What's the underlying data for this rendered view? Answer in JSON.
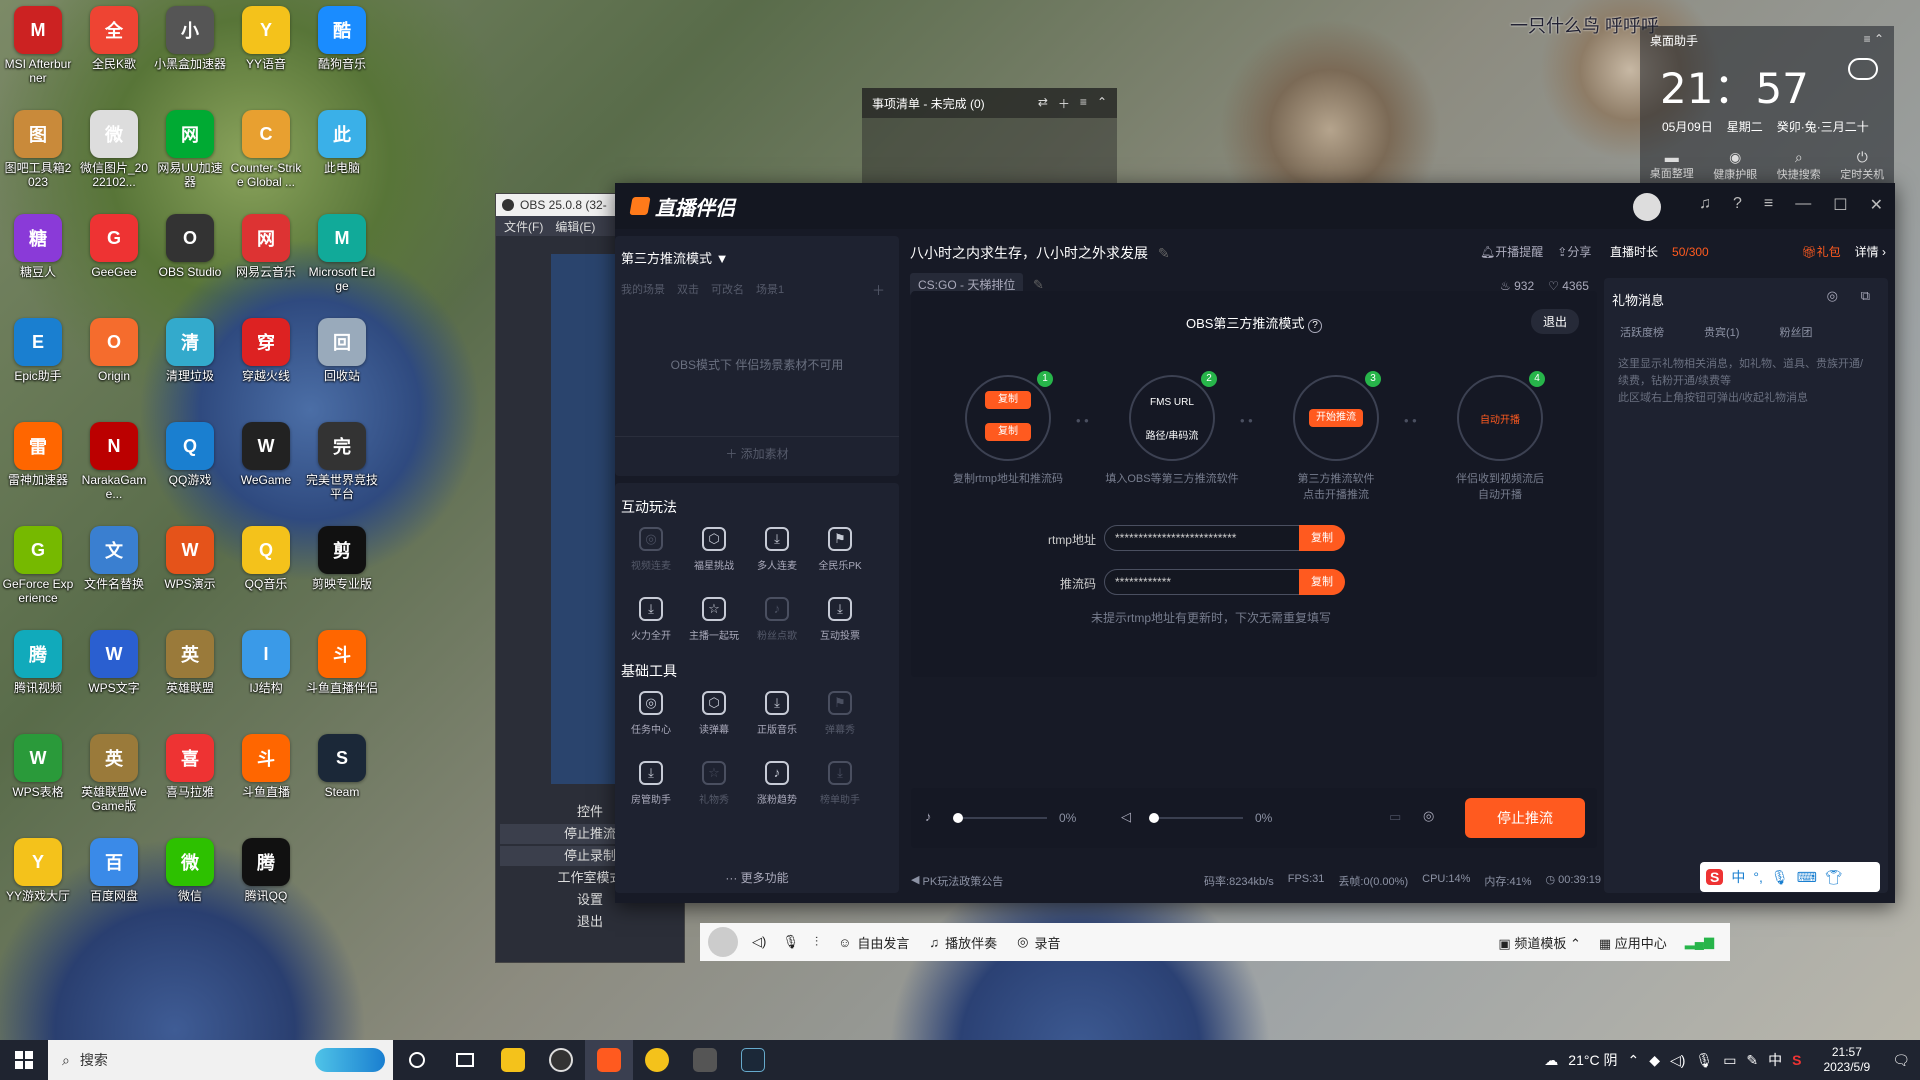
{
  "desktop": {
    "icons": [
      {
        "label": "MSI Afterburner",
        "icon": "msi-afterburner-icon",
        "color": "#c22"
      },
      {
        "label": "全民K歌",
        "icon": "karaoke-icon",
        "color": "#e43"
      },
      {
        "label": "小黑盒加速器",
        "icon": "accelerator-icon",
        "color": "#555"
      },
      {
        "label": "YY语音",
        "icon": "yy-voice-icon",
        "color": "#f4c21b"
      },
      {
        "label": "酷狗音乐",
        "icon": "kugou-icon",
        "color": "#1a8cff"
      },
      {
        "label": "图吧工具箱2023",
        "icon": "toolbox-icon",
        "color": "#c98a3a"
      },
      {
        "label": "微信图片_2022102...",
        "icon": "photo-icon",
        "color": "#ddd"
      },
      {
        "label": "网易UU加速器",
        "icon": "uu-icon",
        "color": "#0a3"
      },
      {
        "label": "Counter-Strike Global ...",
        "icon": "csgo-icon",
        "color": "#e8a030"
      },
      {
        "label": "此电脑",
        "icon": "computer-icon",
        "color": "#3ab0e8"
      },
      {
        "label": "糖豆人",
        "icon": "fall-guys-icon",
        "color": "#8a3ad8"
      },
      {
        "label": "GeeGee",
        "icon": "geegee-icon",
        "color": "#e33"
      },
      {
        "label": "OBS Studio",
        "icon": "obs-icon",
        "color": "#333"
      },
      {
        "label": "网易云音乐",
        "icon": "netease-music-icon",
        "color": "#d33"
      },
      {
        "label": "Microsoft Edge",
        "icon": "edge-icon",
        "color": "#1a9"
      },
      {
        "label": "Epic助手",
        "icon": "epic-icon",
        "color": "#1a7fd0"
      },
      {
        "label": "Origin",
        "icon": "origin-icon",
        "color": "#f56c2d"
      },
      {
        "label": "清理垃圾",
        "icon": "cleaner-icon",
        "color": "#3ac"
      },
      {
        "label": "穿越火线",
        "icon": "crossfire-icon",
        "color": "#d22"
      },
      {
        "label": "回收站",
        "icon": "recycle-bin-icon",
        "color": "#9ab"
      },
      {
        "label": "雷神加速器",
        "icon": "thunder-accelerator-icon",
        "color": "#f60"
      },
      {
        "label": "NarakaGame...",
        "icon": "naraka-icon",
        "color": "#b00"
      },
      {
        "label": "QQ游戏",
        "icon": "qq-game-icon",
        "color": "#1a7fd0"
      },
      {
        "label": "WeGame",
        "icon": "wegame-icon",
        "color": "#222"
      },
      {
        "label": "完美世界竞技平台",
        "icon": "perfect-world-icon",
        "color": "#333"
      },
      {
        "label": "GeForce Experience",
        "icon": "geforce-icon",
        "color": "#76b900"
      },
      {
        "label": "文件名替换",
        "icon": "rename-icon",
        "color": "#3a7fd0"
      },
      {
        "label": "WPS演示",
        "icon": "wps-ppt-icon",
        "color": "#e5531a"
      },
      {
        "label": "QQ音乐",
        "icon": "qq-music-icon",
        "color": "#f4c21b"
      },
      {
        "label": "剪映专业版",
        "icon": "capcut-icon",
        "color": "#111"
      },
      {
        "label": "腾讯视频",
        "icon": "tencent-video-icon",
        "color": "#1ab"
      },
      {
        "label": "WPS文字",
        "icon": "wps-word-icon",
        "color": "#2a5fd0"
      },
      {
        "label": "英雄联盟",
        "icon": "lol-icon",
        "color": "#9a7a3a"
      },
      {
        "label": "IJ结构",
        "icon": "ij-icon",
        "color": "#3a9ae8"
      },
      {
        "label": "斗鱼直播伴侣",
        "icon": "douyu-icon",
        "color": "#f60"
      },
      {
        "label": "WPS表格",
        "icon": "wps-sheet-icon",
        "color": "#2a9a3a"
      },
      {
        "label": "英雄联盟WeGame版",
        "icon": "lol-wegame-icon",
        "color": "#9a7a3a"
      },
      {
        "label": "喜马拉雅",
        "icon": "ximalaya-icon",
        "color": "#e33"
      },
      {
        "label": "斗鱼直播",
        "icon": "douyu-live-icon",
        "color": "#f60"
      },
      {
        "label": "Steam",
        "icon": "steam-icon",
        "color": "#1b2838"
      },
      {
        "label": "YY游戏大厅",
        "icon": "yy-game-icon",
        "color": "#f4c21b"
      },
      {
        "label": "百度网盘",
        "icon": "baidu-pan-icon",
        "color": "#3a8ae8"
      },
      {
        "label": "微信",
        "icon": "wechat-icon",
        "color": "#2dc100"
      },
      {
        "label": "腾讯QQ",
        "icon": "qq-icon",
        "color": "#111"
      }
    ],
    "overlay_text": "一只什么鸟 呼呼呼"
  },
  "widget": {
    "title": "桌面助手",
    "time": "21：57",
    "date": "05月09日",
    "weekday": "星期二",
    "lunar": "癸卯·兔·三月二十",
    "buttons": [
      "桌面整理",
      "健康护眼",
      "快捷搜索",
      "定时关机"
    ]
  },
  "tasklist": {
    "title": "事项清单 - 未完成 (0)"
  },
  "obs": {
    "title": "OBS 25.0.8 (32-",
    "menu": [
      "文件(F)",
      "编辑(E)"
    ],
    "controls_title": "控件",
    "controls": [
      "停止推流",
      "停止录制",
      "工作室模式",
      "设置",
      "退出"
    ]
  },
  "main": {
    "app_name": "直播伴侣",
    "mode_label": "第三方推流模式",
    "scene_tabs": [
      "我的场景",
      "双击",
      "可改名",
      "场景1"
    ],
    "scene_empty": "OBS模式下 伴侣场景素材不可用",
    "add_material": "添加素材",
    "interact_title": "互动玩法",
    "interact_items": [
      {
        "label": "视频连麦",
        "icon": "video-link-icon",
        "dim": true
      },
      {
        "label": "福星挑战",
        "icon": "lucky-star-icon",
        "dim": false
      },
      {
        "label": "多人连麦",
        "icon": "multi-link-icon",
        "dim": false
      },
      {
        "label": "全民乐PK",
        "icon": "pk-icon",
        "dim": false
      },
      {
        "label": "火力全开",
        "icon": "firepower-icon",
        "dim": false
      },
      {
        "label": "主播一起玩",
        "icon": "play-together-icon",
        "dim": false
      },
      {
        "label": "粉丝点歌",
        "icon": "song-request-icon",
        "dim": true
      },
      {
        "label": "互动投票",
        "icon": "vote-icon",
        "dim": false
      }
    ],
    "tools_title": "基础工具",
    "tools_items": [
      {
        "label": "任务中心",
        "icon": "task-center-icon",
        "dim": false
      },
      {
        "label": "读弹幕",
        "icon": "read-danmaku-icon",
        "dim": false
      },
      {
        "label": "正版音乐",
        "icon": "music-icon",
        "dim": false
      },
      {
        "label": "弹幕秀",
        "icon": "danmaku-show-icon",
        "dim": true
      },
      {
        "label": "房管助手",
        "icon": "room-admin-icon",
        "dim": false
      },
      {
        "label": "礼物秀",
        "icon": "gift-show-icon",
        "dim": true
      },
      {
        "label": "涨粉趋势",
        "icon": "fan-trend-icon",
        "dim": false
      },
      {
        "label": "榜单助手",
        "icon": "rank-helper-icon",
        "dim": true
      }
    ],
    "more_functions": "更多功能",
    "room_title": "八小时之内求生存，八小时之外求发展",
    "category": "CS:GO - 天梯排位",
    "remind": "开播提醒",
    "share": "分享",
    "hot": "932",
    "likes": "4365",
    "obs_mode_title": "OBS第三方推流模式",
    "exit_label": "退出",
    "steps": [
      {
        "num": "1",
        "label": "复制rtmp地址和推流码"
      },
      {
        "num": "2",
        "label": "填入OBS等第三方推流软件"
      },
      {
        "num": "3",
        "label": "第三方推流软件\n点击开播推流"
      },
      {
        "num": "4",
        "label": "伴侣收到视频流后\n自动开播"
      }
    ],
    "copy_label": "复制",
    "fms_url": "FMS URL",
    "path_label": "路径/串码流",
    "start_push": "开始推流",
    "auto_start": "自动开播",
    "rtmp_label": "rtmp地址",
    "rtmp_value": "**************************",
    "key_label": "推流码",
    "key_value": "************",
    "rtmp_hint": "未提示rtmp地址有更新时，下次无需重复填写",
    "mic_volume": "0%",
    "speaker_volume": "0%",
    "stop_push": "停止推流",
    "pk_notice": "PK玩法政策公告",
    "bitrate": "码率:8234kb/s",
    "fps": "FPS:31",
    "drop": "丢帧:0(0.00%)",
    "cpu": "CPU:14%",
    "mem": "内存:41%",
    "duration": "00:39:19",
    "live_duration_label": "直播时长",
    "live_count": "50/300",
    "gift_pack": "礼包",
    "details": "详情",
    "gift_msg_title": "礼物消息",
    "gift_tabs": [
      "活跃度榜",
      "贵宾(1)",
      "粉丝团"
    ],
    "gift_hint": "这里显示礼物相关消息，如礼物、道具、贵族开通/续费，钻粉开通/续费等\n此区域右上角按钮可弹出/收起礼物消息"
  },
  "voicebar": {
    "items": [
      "自由发言",
      "播放伴奏",
      "录音"
    ],
    "right_items": [
      "频道模板",
      "应用中心"
    ]
  },
  "taskbar": {
    "search_placeholder": "搜索",
    "weather": "21°C 阴",
    "ime": "中",
    "time": "21:57",
    "date": "2023/5/9"
  }
}
